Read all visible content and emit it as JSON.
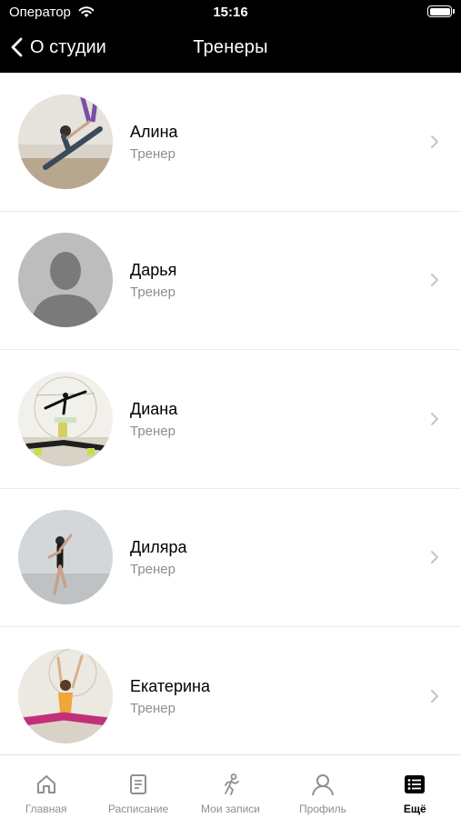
{
  "status_bar": {
    "carrier": "Оператор",
    "time": "15:16"
  },
  "nav": {
    "back_label": "О студии",
    "title": "Тренеры"
  },
  "trainers": [
    {
      "name": "Алина",
      "role": "Тренер",
      "photo": "aerial-yoga-photo"
    },
    {
      "name": "Дарья",
      "role": "Тренер",
      "photo": "placeholder-silhouette"
    },
    {
      "name": "Диана",
      "role": "Тренер",
      "photo": "lady-stretch-logo-photo"
    },
    {
      "name": "Диляра",
      "role": "Тренер",
      "photo": "dance-pose-photo"
    },
    {
      "name": "Екатерина",
      "role": "Тренер",
      "photo": "lady-stretch-split-photo"
    }
  ],
  "tabbar": {
    "items": [
      {
        "label": "Главная",
        "icon": "home-icon",
        "active": false
      },
      {
        "label": "Расписание",
        "icon": "document-icon",
        "active": false
      },
      {
        "label": "Мои записи",
        "icon": "running-person-icon",
        "active": false
      },
      {
        "label": "Профиль",
        "icon": "person-icon",
        "active": false
      },
      {
        "label": "Ещё",
        "icon": "list-icon",
        "active": true
      }
    ]
  },
  "colors": {
    "header_bg": "#000000",
    "secondary_text": "#8e8e93",
    "separator": "#ebebeb"
  }
}
